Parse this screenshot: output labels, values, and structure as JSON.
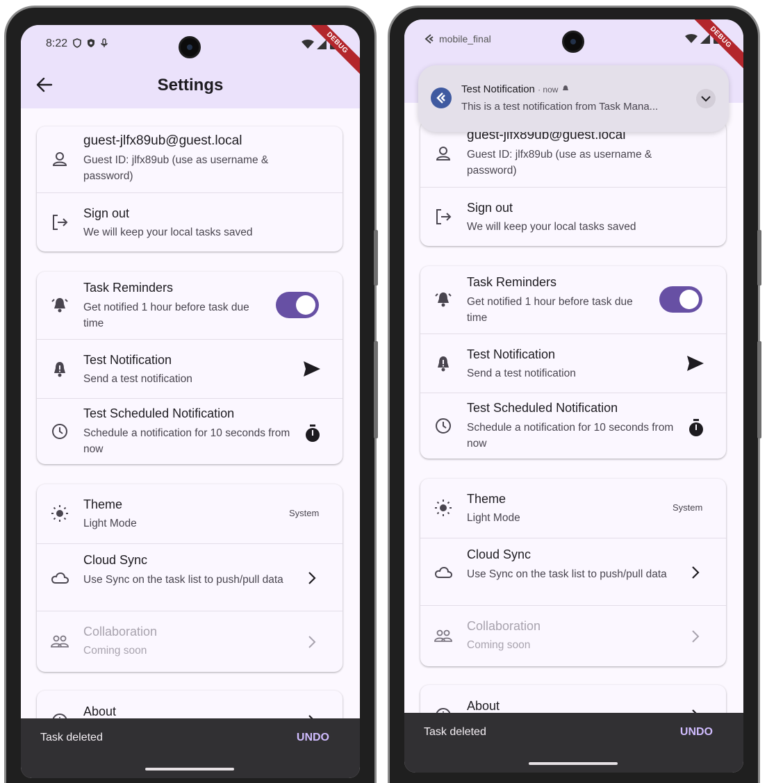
{
  "statusbar": {
    "time": "8:22"
  },
  "debug_banner": "DEBUG",
  "appbar": {
    "title": "Settings"
  },
  "notification": {
    "app_label": "mobile_final",
    "title": "Test Notification",
    "meta": "· now",
    "body": "This is a test notification from Task Mana..."
  },
  "account": {
    "email": "guest-jlfx89ub@guest.local",
    "email_partial": "guest-jlfx89ub@guest.local",
    "guest_id": "Guest ID: jlfx89ub (use as username & password)",
    "signout_title": "Sign out",
    "signout_sub": "We will keep your local tasks saved"
  },
  "notifications": {
    "reminders_title": "Task Reminders",
    "reminders_sub": "Get notified 1 hour before task due time",
    "reminders_enabled": true,
    "test_title": "Test Notification",
    "test_sub": "Send a test notification",
    "scheduled_title": "Test Scheduled Notification",
    "scheduled_sub": "Schedule a notification for 10 seconds from now"
  },
  "preferences": {
    "theme_title": "Theme",
    "theme_sub": "Light Mode",
    "theme_value": "System",
    "sync_title": "Cloud Sync",
    "sync_sub": "Use Sync on the task list to push/pull data",
    "collab_title": "Collaboration",
    "collab_sub": "Coming soon"
  },
  "about": {
    "title": "About"
  },
  "snackbar": {
    "message": "Task deleted",
    "action": "UNDO"
  },
  "colors": {
    "accent": "#6750a4",
    "appbar": "#ebe2fb",
    "background": "#fcf8ff",
    "snackbar": "#313033",
    "snack_action": "#d0bcff"
  }
}
